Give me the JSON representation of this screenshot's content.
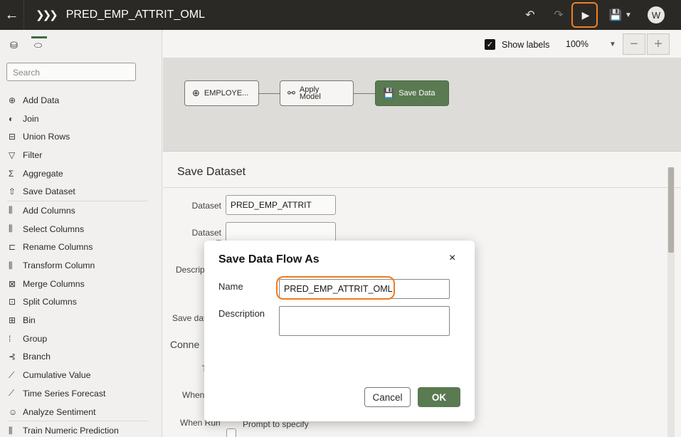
{
  "topbar": {
    "title": "PRED_EMP_ATTRIT_OML",
    "avatar_initial": "W",
    "icons": [
      "back-arrow-icon",
      "chevrons-right-icon",
      "undo-icon",
      "redo-icon",
      "run-icon",
      "save-icon",
      "dropdown-caret-icon"
    ]
  },
  "sidebar": {
    "search_placeholder": "Search",
    "steps": [
      {
        "label": "Add Data",
        "icon": "add-data-icon"
      },
      {
        "label": "Join",
        "icon": "join-icon"
      },
      {
        "label": "Union Rows",
        "icon": "union-rows-icon"
      },
      {
        "label": "Filter",
        "icon": "filter-icon"
      },
      {
        "label": "Aggregate",
        "icon": "sigma-icon"
      },
      {
        "label": "Save Dataset",
        "icon": "upload-icon"
      },
      {
        "label": "Add Columns",
        "icon": "add-columns-icon"
      },
      {
        "label": "Select Columns",
        "icon": "select-columns-icon"
      },
      {
        "label": "Rename Columns",
        "icon": "rename-columns-icon"
      },
      {
        "label": "Transform Column",
        "icon": "transform-column-icon"
      },
      {
        "label": "Merge Columns",
        "icon": "merge-columns-icon"
      },
      {
        "label": "Split Columns",
        "icon": "split-columns-icon"
      },
      {
        "label": "Bin",
        "icon": "bin-icon"
      },
      {
        "label": "Group",
        "icon": "group-icon"
      },
      {
        "label": "Branch",
        "icon": "branch-icon"
      },
      {
        "label": "Cumulative Value",
        "icon": "cumulative-icon"
      },
      {
        "label": "Time Series Forecast",
        "icon": "forecast-icon"
      },
      {
        "label": "Analyze Sentiment",
        "icon": "smile-icon"
      },
      {
        "label": "Train Numeric Prediction",
        "icon": "train-icon"
      }
    ]
  },
  "toolbar": {
    "show_labels": "Show labels",
    "zoom": "100%",
    "zoom_out": "−",
    "zoom_in": "+"
  },
  "canvas": {
    "nodes": [
      {
        "label": "EMPLOYE...",
        "icon": "add-data-icon"
      },
      {
        "label": "Apply\nModel",
        "icon": "apply-model-icon"
      },
      {
        "label": "Save Data",
        "icon": "save-icon"
      }
    ]
  },
  "properties": {
    "title": "Save Dataset",
    "dataset_label": "Dataset",
    "dataset_value": "PRED_EMP_ATTRIT",
    "dataset_table_label": "Dataset",
    "dataset_table_label_2": "T",
    "description_label": "Descrip",
    "save_data_label": "Save dat",
    "connection_label": "Conne",
    "t_label": "T",
    "when_label": "When",
    "when_run_label": "When Run",
    "prompt_label": "Prompt to specify"
  },
  "modal": {
    "title": "Save Data Flow As",
    "close": "×",
    "name_label": "Name",
    "name_value": "PRED_EMP_ATTRIT_OML",
    "description_label": "Description",
    "description_value": "",
    "cancel": "Cancel",
    "ok": "OK"
  },
  "colors": {
    "topbar_bg": "#2b2926",
    "accent_green": "#5a7a52",
    "highlight_orange": "#f08020"
  }
}
